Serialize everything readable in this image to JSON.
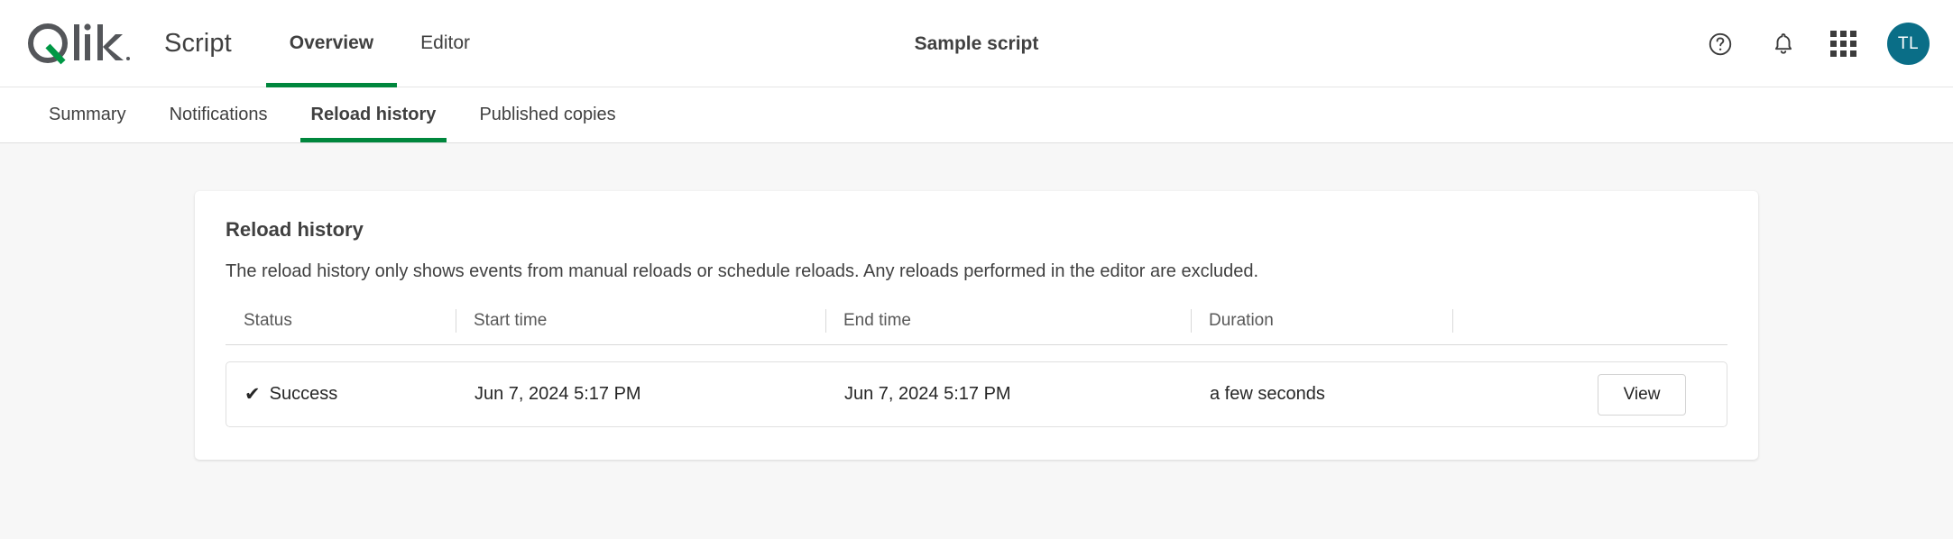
{
  "header": {
    "logo_text": "Qlik",
    "app_kind": "Script",
    "title": "Sample script",
    "tabs": [
      {
        "label": "Overview",
        "active": true
      },
      {
        "label": "Editor",
        "active": false
      }
    ],
    "actions": {
      "help_icon": "help-circle-icon",
      "notifications_icon": "bell-icon",
      "apps_icon": "grid-apps-icon",
      "avatar_initials": "TL",
      "avatar_color": "#0a6e87"
    }
  },
  "subtabs": [
    {
      "label": "Summary",
      "active": false
    },
    {
      "label": "Notifications",
      "active": false
    },
    {
      "label": "Reload history",
      "active": true
    },
    {
      "label": "Published copies",
      "active": false
    }
  ],
  "card": {
    "title": "Reload history",
    "description": "The reload history only shows events from manual reloads or schedule reloads. Any reloads performed in the editor are excluded.",
    "table": {
      "columns": [
        "Status",
        "Start time",
        "End time",
        "Duration",
        ""
      ],
      "rows": [
        {
          "status_icon": "check-icon",
          "status": "Success",
          "start_time": "Jun 7, 2024 5:17 PM",
          "end_time": "Jun 7, 2024 5:17 PM",
          "duration": "a few seconds",
          "action_label": "View"
        }
      ]
    }
  },
  "colors": {
    "accent_green": "#00873d",
    "page_bg": "#f7f7f7"
  }
}
